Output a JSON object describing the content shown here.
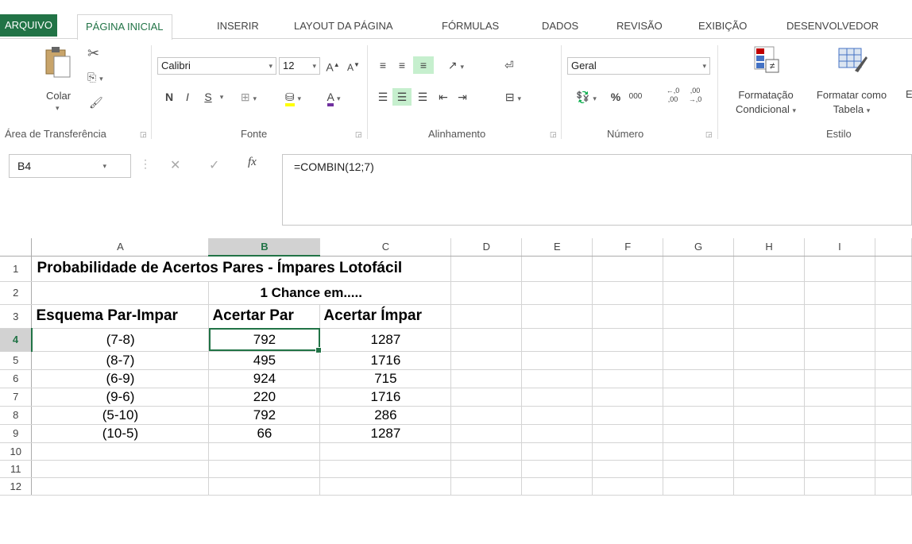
{
  "tabs": [
    "ARQUIVO",
    "PÁGINA INICIAL",
    "INSERIR",
    "LAYOUT DA PÁGINA",
    "FÓRMULAS",
    "DADOS",
    "REVISÃO",
    "EXIBIÇÃO",
    "DESENVOLVEDOR"
  ],
  "ribbon": {
    "clipboard": {
      "paste_label": "Colar",
      "group_label": "Área de Transferência"
    },
    "font": {
      "name": "Calibri",
      "size": "12",
      "bold": "N",
      "italic": "I",
      "underline": "S",
      "group_label": "Fonte"
    },
    "alignment": {
      "group_label": "Alinhamento"
    },
    "number": {
      "format": "Geral",
      "percent": "%",
      "thousands": "000",
      "inc_decimal": "←,0\n,00",
      "dec_decimal": ",00\n→,0",
      "group_label": "Número"
    },
    "styles": {
      "conditional_line1": "Formatação",
      "conditional_line2": "Condicional",
      "table_line1": "Formatar como",
      "table_line2": "Tabela",
      "truncated": "E",
      "group_label": "Estilo"
    }
  },
  "formula_bar": {
    "name_box": "B4",
    "fx": "fx",
    "formula": "=COMBIN(12;7)"
  },
  "sheet": {
    "columns": [
      "A",
      "B",
      "C",
      "D",
      "E",
      "F",
      "G",
      "H",
      "I"
    ],
    "rows": [
      "1",
      "2",
      "3",
      "4",
      "5",
      "6",
      "7",
      "8",
      "9",
      "10",
      "11",
      "12"
    ],
    "title": "Probabilidade de Acertos Pares - Ímpares Lotofácil",
    "subtitle": "1 Chance em.....",
    "headers": [
      "Esquema Par-Impar",
      "Acertar Par",
      "Acertar Ímpar"
    ],
    "data": [
      [
        "(7-8)",
        "792",
        "1287"
      ],
      [
        "(8-7)",
        "495",
        "1716"
      ],
      [
        "(6-9)",
        "924",
        "715"
      ],
      [
        "(9-6)",
        "220",
        "1716"
      ],
      [
        "(5-10)",
        "792",
        "286"
      ],
      [
        "(10-5)",
        "66",
        "1287"
      ]
    ]
  },
  "colors": {
    "accent": "#217346",
    "subtitle": "#7030a0"
  }
}
